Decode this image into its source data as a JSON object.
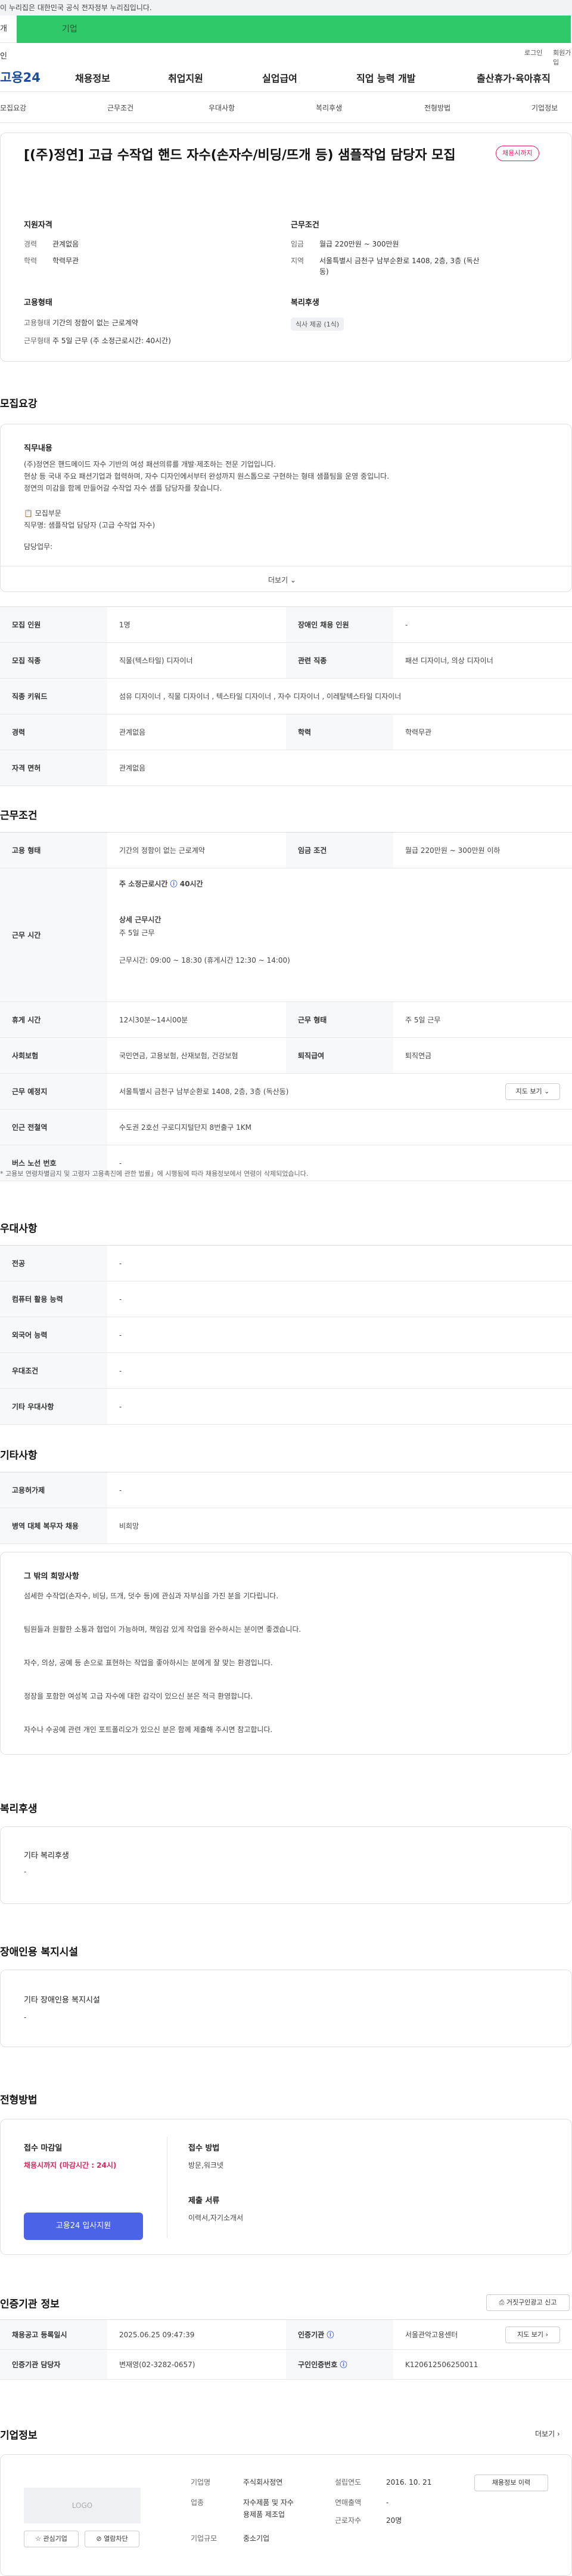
{
  "gov_banner": "이 누리집은 대한민국 공식 전자정부 누리집입니다.",
  "top_tabs": {
    "individual": "개인",
    "business": "기업"
  },
  "util": {
    "login": "로그인",
    "signup": "회원가입"
  },
  "brand": "고용24",
  "gnb": [
    "채용정보",
    "취업지원",
    "실업급여",
    "직업 능력 개발",
    "출산휴가·육아휴직"
  ],
  "anchors": [
    "모집요강",
    "근무조건",
    "우대사항",
    "복리후생",
    "전형방법",
    "기업정보"
  ],
  "job": {
    "title": "[(주)정연] 고급 수작업 핸드 자수(손자수/비딩/뜨개 등) 샘플작업 담당자 모집",
    "badge": "채용시까지",
    "qual_title": "지원자격",
    "career_k": "경력",
    "career_v": "관계없음",
    "edu_k": "학력",
    "edu_v": "학력무관",
    "cond_title": "근무조건",
    "wage_k": "임금",
    "wage_v": "월급 220만원 ~ 300만원",
    "area_k": "지역",
    "area_v1": "서울특별시 금천구 남부순환로 1408, 2층, 3층 (독산",
    "area_v2": "동)",
    "emp_title": "고용형태",
    "emp_k": "고용형태",
    "emp_v": "기간의 정함이 없는 근로계약",
    "work_k": "근무형태",
    "work_v": "주 5일 근무 (주 소정근로시간: 40시간)",
    "welfare_title": "복리후생",
    "welfare_pill": "식사 제공 (1식)"
  },
  "recruit": {
    "heading": "모집요강",
    "duty_label": "직무내용",
    "duty_lines": [
      "(주)정연은 핸드메이드 자수 기반의 여성 패션의류를 개발·제조하는 전문 기업입니다.",
      "현상 등 국내 주요 패션기업과 협력하며, 자수 디자인에서부터 완성까지 원스톱으로 구현하는 형태 샘플팀을 운영 중입니다.",
      "정연의 미감을 함께 만들어갈 수작업 자수 샘플 담당자를 찾습니다."
    ],
    "sub1": "📋 모집부문",
    "sub2": "직무명: 샘플작업 담당자 (고급 수작업 자수)",
    "sub3": "담당업무:",
    "more": "더보기 ⌄",
    "rows": [
      {
        "k": "모집 인원",
        "v": "1명",
        "k2": "장애인 채용 인원",
        "v2": "-"
      },
      {
        "k": "모집 직종",
        "v": "직물(텍스타일) 디자이너",
        "k2": "관련 직종",
        "v2": "패션 디자이너, 의상 디자이너"
      },
      {
        "k": "직종 키워드",
        "v": "섬유 디자이너 , 직물 디자이너 , 텍스타일 디자이너 , 자수 디자이너 , 이레탈텍스타일 디자이너",
        "k2": "",
        "v2": ""
      },
      {
        "k": "경력",
        "v": "관계없음",
        "k2": "학력",
        "v2": "학력무관"
      },
      {
        "k": "자격 면허",
        "v": "관계없음",
        "k2": "",
        "v2": ""
      }
    ]
  },
  "work": {
    "heading": "근무조건",
    "emp_k": "고용 형태",
    "emp_v": "기간의 정함이 없는 근로계약",
    "wage_k": "임금 조건",
    "wage_v": "월급 220만원 ~ 300만원 이하",
    "time_k": "근무 시간",
    "time_a": "주 소정근로시간",
    "time_b": "40시간",
    "detail_t": "상세 근무시간",
    "detail_a": "주 5일 근무",
    "detail_b": "근무시간: 09:00 ~ 18:30 (휴게시간 12:30 ~ 14:00)",
    "rest_k": "휴게 시간",
    "rest_v": "12시30분~14시00분",
    "form_k": "근무 형태",
    "form_v": "주 5일 근무",
    "ins_k": "사회보험",
    "ins_v": "국민연금, 고용보험, 산재보험, 건강보험",
    "ret_k": "퇴직급여",
    "ret_v": "퇴직연금",
    "place_k": "근무 예정지",
    "place_v": "서울특별시 금천구 남부순환로 1408, 2층, 3층 (독산동)",
    "map_btn": "지도 보기 ⌄",
    "subway_k": "인근 전철역",
    "subway_v": "수도권 2호선 구로디지털단지 8번출구 1KM",
    "bus_k": "버스 노선 번호",
    "bus_v": "-",
    "note": "* 고용보 연령차별금지 및 고령자 고용촉진에 관한 법률」에 시행됨에 따라 채용정보에서 연령이 삭제되었습니다."
  },
  "pref": {
    "heading": "우대사항",
    "rows": [
      {
        "k": "전공",
        "v": "-"
      },
      {
        "k": "컴퓨터 활용 능력",
        "v": "-"
      },
      {
        "k": "외국어 능력",
        "v": "-"
      },
      {
        "k": "우대조건",
        "v": "-"
      },
      {
        "k": "기타 우대사항",
        "v": "-"
      }
    ]
  },
  "etc": {
    "heading": "기타사항",
    "rows": [
      {
        "k": "고용허가제",
        "v": "-"
      },
      {
        "k": "병역 대체 복무자 채용",
        "v": "비희망"
      }
    ],
    "box_title": "그 밖의 희망사항",
    "box_lines": [
      "섬세한 수작업(손자수, 비딩, 뜨개, 덧수 등)에 관심과 자부심을 가진 분을 기다립니다.",
      "팀원들과 원활한 소통과 협업이 가능하며, 책임감 있게 작업을 완수하시는 분이면 좋겠습니다.",
      "자수, 의상, 공예 등 손으로 표현하는 작업을 좋아하시는 분에게 잘 맞는 환경입니다.",
      "정장을 포함한 여성복 고급 자수에 대한 감각이 있으신 분은 적극 환영합니다.",
      "자수나 수공예 관련 개인 포트폴리오가 있으신 분은 함께 제출해 주시면 참고합니다."
    ]
  },
  "welfare": {
    "heading": "복리후생",
    "label": "기타 복리후생",
    "value": "-"
  },
  "disabled": {
    "heading": "장애인용 복지시설",
    "label": "기타 장애인용 복지시설",
    "value": "-"
  },
  "screening": {
    "heading": "전형방법",
    "deadline_label": "접수 마감일",
    "deadline_value": "채용시까지 (마감시간 : 24시)",
    "method_label": "접수 방법",
    "method_value": "방문,워크넷",
    "docs_label": "제출 서류",
    "docs_value": "이력서,자기소개서",
    "apply": "고용24 입사지원"
  },
  "cert": {
    "heading": "인증기관 정보",
    "print": "거짓구인광고 신고",
    "reg_k": "채용공고 등록일시",
    "reg_v": "2025.06.25 09:47:39",
    "agency_k": "인증기관",
    "agency_v": "서울관악고용센터",
    "map": "지도 보기 ›",
    "mgr_k": "인증기관 담당자",
    "mgr_v": "변재영(02-3282-0657)",
    "num_k": "구인인증번호",
    "num_v": "K120612506250011"
  },
  "company": {
    "heading": "기업정보",
    "more": "더보기 ›",
    "logo": "LOGO",
    "fav": "☆ 관심기업",
    "block": "⊘ 열람차단",
    "name_k": "기업명",
    "name_v": "주식회사정연",
    "ind_k": "업종",
    "ind_v1": "자수제품 및 자수",
    "ind_v2": "용제품 제조업",
    "size_k": "기업규모",
    "size_v": "중소기업",
    "est_k": "설립연도",
    "est_v": "2016. 10. 21",
    "sales_k": "연매출액",
    "sales_v": "-",
    "emp_k": "근로자수",
    "emp_v": "20명",
    "history": "채용정보 이력"
  }
}
